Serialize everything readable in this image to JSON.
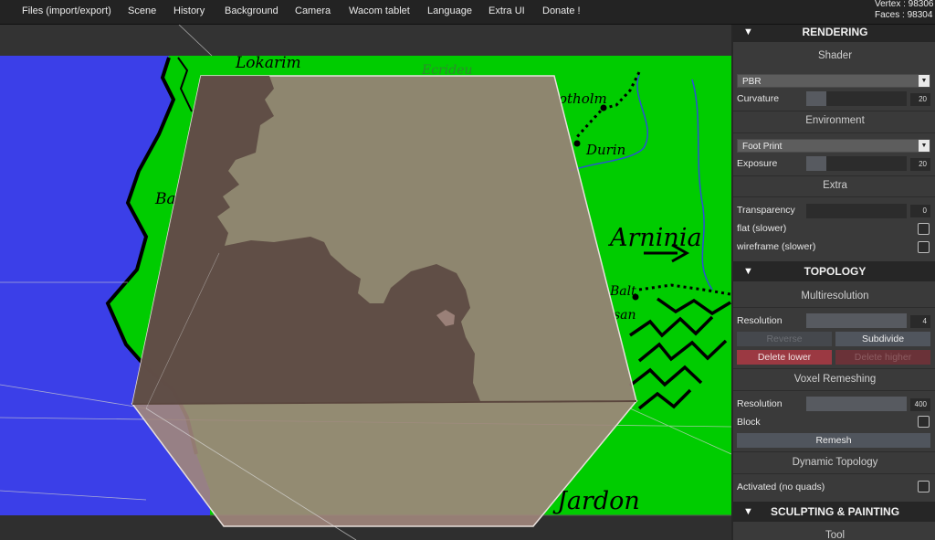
{
  "menu": [
    "Files (import/export)",
    "Scene",
    "History",
    "Background",
    "Camera",
    "Wacom tablet",
    "Language",
    "Extra UI",
    "Donate !"
  ],
  "stats": {
    "vertex": "Vertex : 98306",
    "faces": "Faces : 98304"
  },
  "map_labels": [
    "Lokarim",
    "Ecrideu",
    "otholm",
    "Durin",
    "Ba",
    "Arninia",
    "Balt",
    "san",
    "Jardon"
  ],
  "panel": {
    "rendering": {
      "title": "RENDERING",
      "shader_title": "Shader",
      "shader_value": "PBR",
      "curvature_label": "Curvature",
      "curvature_value": "20",
      "environment_title": "Environment",
      "environment_value": "Foot Print",
      "exposure_label": "Exposure",
      "exposure_value": "20",
      "extra_title": "Extra",
      "transparency_label": "Transparency",
      "transparency_value": "0",
      "flat_label": "flat (slower)",
      "wireframe_label": "wireframe (slower)"
    },
    "topology": {
      "title": "TOPOLOGY",
      "multires_title": "Multiresolution",
      "resolution_label": "Resolution",
      "resolution_value": "4",
      "reverse_label": "Reverse",
      "subdivide_label": "Subdivide",
      "delete_lower_label": "Delete lower",
      "delete_higher_label": "Delete higher",
      "voxel_title": "Voxel Remeshing",
      "voxel_resolution_label": "Resolution",
      "voxel_resolution_value": "400",
      "block_label": "Block",
      "remesh_label": "Remesh",
      "dynamic_title": "Dynamic Topology",
      "activated_label": "Activated (no quads)"
    },
    "sculpting": {
      "title": "SCULPTING & PAINTING",
      "tool_title": "Tool"
    }
  },
  "colors": {
    "map_sea": "#3b3fe8",
    "map_land": "#00cc00",
    "cube_face": "#9a8078",
    "panel_bg": "#3a3a3a",
    "danger": "#9b3942"
  }
}
